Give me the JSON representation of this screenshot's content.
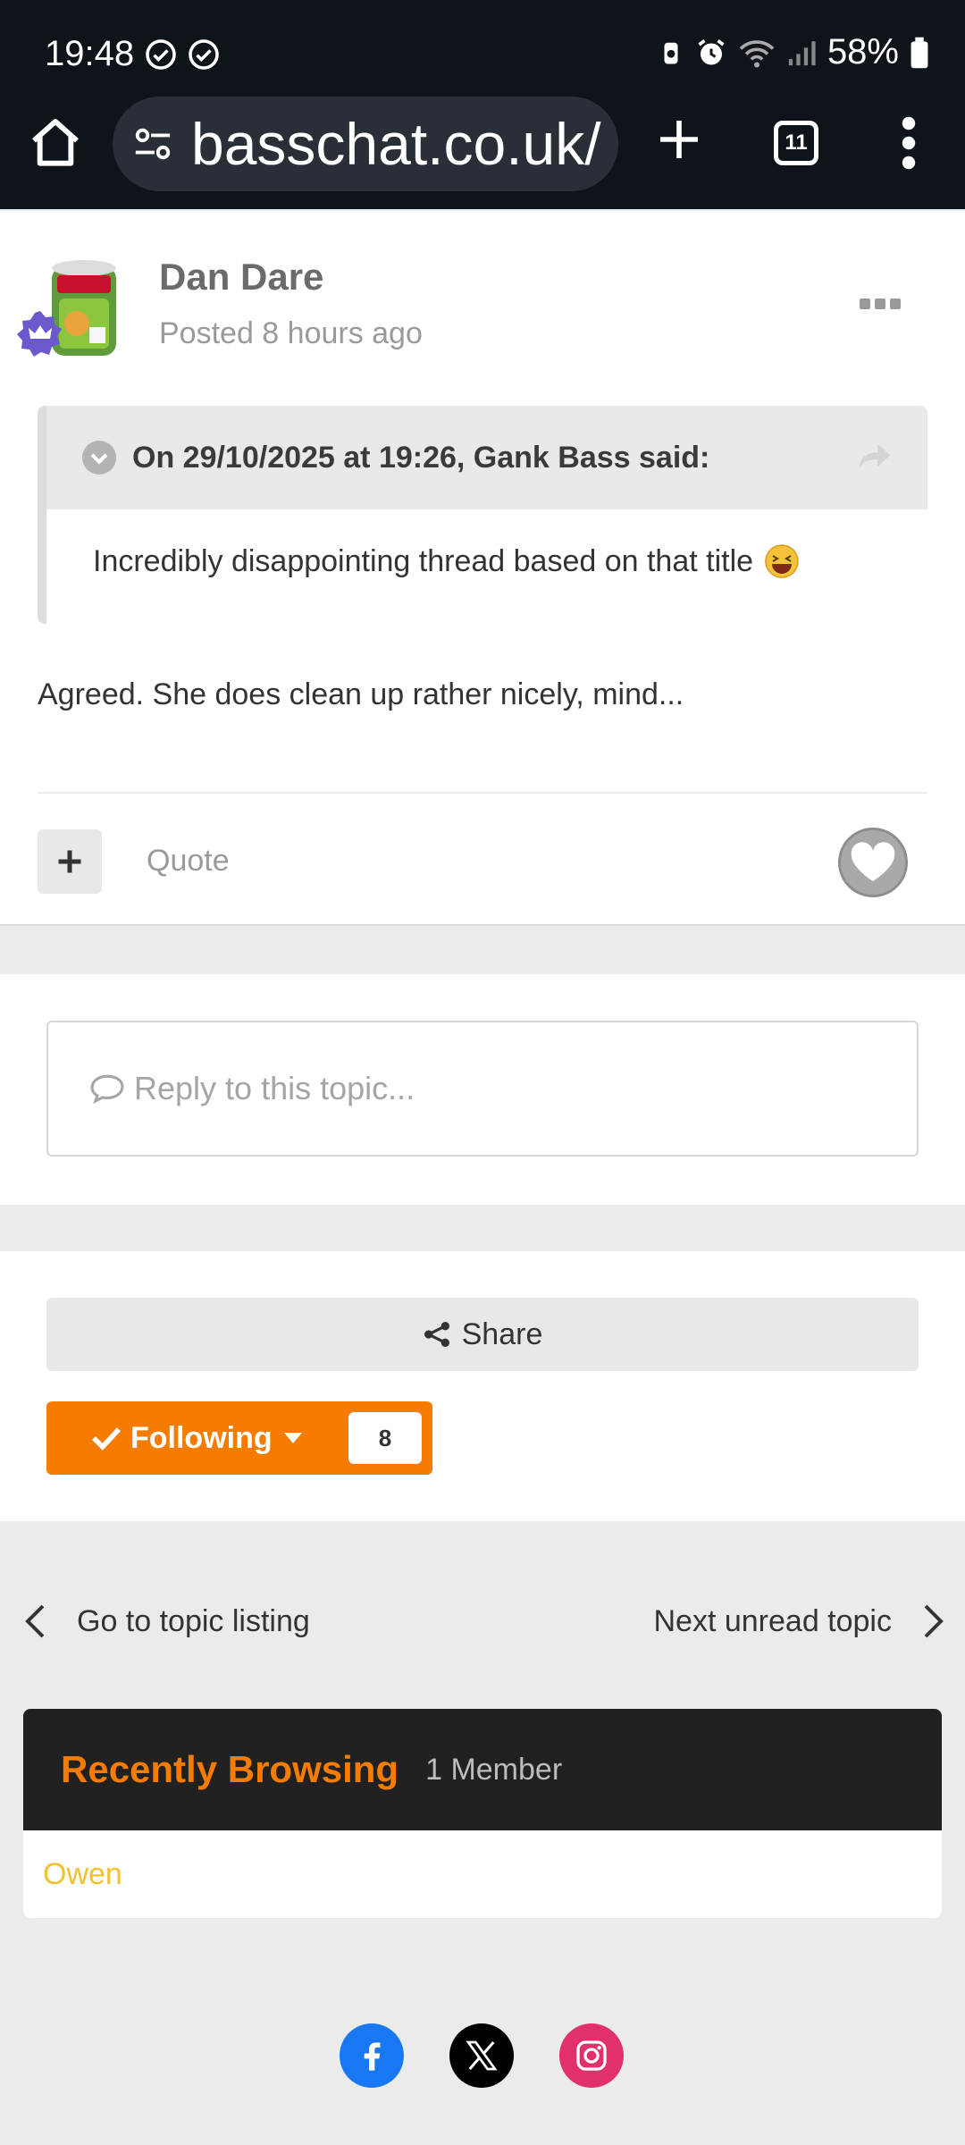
{
  "status": {
    "time": "19:48",
    "battery": "58%"
  },
  "browser": {
    "url": "basschat.co.uk/",
    "tab_count": "11"
  },
  "post": {
    "author": "Dan Dare",
    "posted": "Posted 8 hours ago",
    "quote_header": "On 29/10/2025 at 19:26, Gank Bass said:",
    "quote_text": "Incredibly disappointing thread based on that title",
    "body": "Agreed. She does clean up rather nicely, mind...",
    "quote_button": "Quote"
  },
  "reply": {
    "placeholder": "Reply to this topic..."
  },
  "actions": {
    "share_label": "Share",
    "following_label": "Following",
    "following_count": "8"
  },
  "navigation": {
    "prev_label": "Go to topic listing",
    "next_label": "Next unread topic"
  },
  "recently_browsing": {
    "title": "Recently Browsing",
    "count": "1 Member",
    "members": [
      "Owen"
    ]
  },
  "colors": {
    "accent": "#f57c00",
    "chrome_bg": "#0f141b",
    "member_name": "#f2c12e",
    "facebook": "#1877f2",
    "x": "#000000",
    "instagram": "#e1306c"
  },
  "social_icons": [
    "facebook-icon",
    "x-icon",
    "instagram-icon"
  ]
}
